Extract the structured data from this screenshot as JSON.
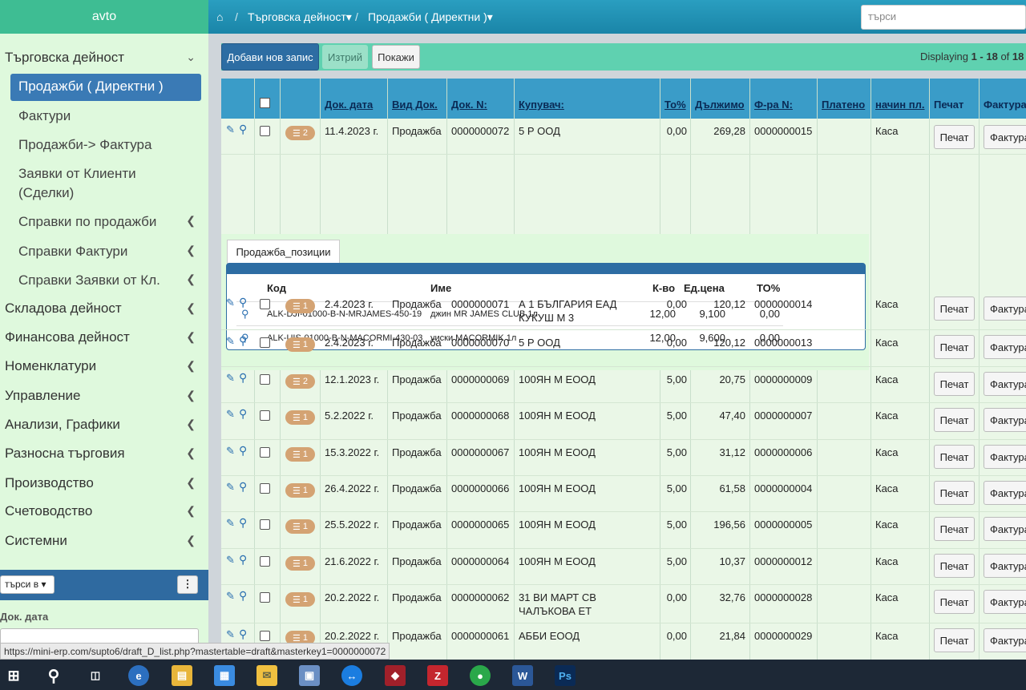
{
  "sidebar": {
    "brand": "avto",
    "section_main": "Търговска дейност",
    "active_item": "Продажби ( Директни )",
    "sub_items": [
      "Фактури",
      "Продажби-> Фактура",
      "Заявки от Клиенти (Сделки)",
      "Справки по продажби",
      "Справки Фактури",
      "Справки Заявки от Кл."
    ],
    "sections": [
      "Складова дейност",
      "Финансова дейност",
      "Номенклатури",
      "Управление",
      "Анализи, Графики",
      "Разносна търговия",
      "Производство",
      "Счетоводство",
      "Системни"
    ],
    "search_in_label": "търси в",
    "doc_date_label": "Док. дата"
  },
  "topbar": {
    "crumb1": "Търговска дейност",
    "crumb2": "Продажби ( Директни )",
    "search_placeholder": "търси"
  },
  "toolbar": {
    "add_label": "Добави нов запис",
    "delete_label": "Изтрий",
    "show_label": "Покажи",
    "displaying_prefix": "Displaying ",
    "displaying_range": "1 - 18",
    "displaying_of": " of ",
    "displaying_total": "18"
  },
  "table": {
    "headers": {
      "doc_date": "Док. дата",
      "doc_type": "Вид Док.",
      "doc_no": "Док. N:",
      "buyer": "Купувач:",
      "to_pct": "То%",
      "due": "Дължимо",
      "invoice_no": "Ф-ра N:",
      "paid": "Платено",
      "pay_method": "начин пл.",
      "print": "Печат",
      "invoice": "Фактура"
    },
    "rows": [
      {
        "badge": "2",
        "date": "11.4.2023 г.",
        "type": "Продажба",
        "no": "0000000072",
        "buyer1": "5 Р ООД",
        "buyer2": "",
        "to": "0,00",
        "due": "269,28",
        "inv": "0000000015",
        "pay": "Каса",
        "print": "Печат",
        "invoice": "Фактура"
      },
      {
        "badge": "1",
        "date": "2.4.2023 г.",
        "type": "Продажба",
        "no": "0000000071",
        "buyer1": "А 1 БЪЛГАРИЯ ЕАД",
        "buyer2": "КУКУШ М 3",
        "to": "0,00",
        "due": "120,12",
        "inv": "0000000014",
        "pay": "Каса",
        "print": "Печат",
        "invoice": "Фактура"
      },
      {
        "badge": "1",
        "date": "2.4.2023 г.",
        "type": "Продажба",
        "no": "0000000070",
        "buyer1": "5 Р ООД",
        "buyer2": "",
        "to": "0,00",
        "due": "120,12",
        "inv": "0000000013",
        "pay": "Каса",
        "print": "Печат",
        "invoice": "Фактура"
      },
      {
        "badge": "2",
        "date": "12.1.2023 г.",
        "type": "Продажба",
        "no": "0000000069",
        "buyer1": "100ЯН М ЕООД",
        "buyer2": "",
        "to": "5,00",
        "due": "20,75",
        "inv": "0000000009",
        "pay": "Каса",
        "print": "Печат",
        "invoice": "Фактура"
      },
      {
        "badge": "1",
        "date": "5.2.2022 г.",
        "type": "Продажба",
        "no": "0000000068",
        "buyer1": "100ЯН М ЕООД",
        "buyer2": "",
        "to": "5,00",
        "due": "47,40",
        "inv": "0000000007",
        "pay": "Каса",
        "print": "Печат",
        "invoice": "Фактура"
      },
      {
        "badge": "1",
        "date": "15.3.2022 г.",
        "type": "Продажба",
        "no": "0000000067",
        "buyer1": "100ЯН М ЕООД",
        "buyer2": "",
        "to": "5,00",
        "due": "31,12",
        "inv": "0000000006",
        "pay": "Каса",
        "print": "Печат",
        "invoice": "Фактура"
      },
      {
        "badge": "1",
        "date": "26.4.2022 г.",
        "type": "Продажба",
        "no": "0000000066",
        "buyer1": "100ЯН М ЕООД",
        "buyer2": "",
        "to": "5,00",
        "due": "61,58",
        "inv": "0000000004",
        "pay": "Каса",
        "print": "Печат",
        "invoice": "Фактура"
      },
      {
        "badge": "1",
        "date": "25.5.2022 г.",
        "type": "Продажба",
        "no": "0000000065",
        "buyer1": "100ЯН М ЕООД",
        "buyer2": "",
        "to": "5,00",
        "due": "196,56",
        "inv": "0000000005",
        "pay": "Каса",
        "print": "Печат",
        "invoice": "Фактура"
      },
      {
        "badge": "1",
        "date": "21.6.2022 г.",
        "type": "Продажба",
        "no": "0000000064",
        "buyer1": "100ЯН М ЕООД",
        "buyer2": "",
        "to": "5,00",
        "due": "10,37",
        "inv": "0000000012",
        "pay": "Каса",
        "print": "Печат",
        "invoice": "Фактура"
      },
      {
        "badge": "1",
        "date": "20.2.2022 г.",
        "type": "Продажба",
        "no": "0000000062",
        "buyer1": "31 ВИ МАРТ СВ",
        "buyer2": "ЧАЛЪКОВА ЕТ",
        "to": "0,00",
        "due": "32,76",
        "inv": "0000000028",
        "pay": "Каса",
        "print": "Печат",
        "invoice": "Фактура"
      },
      {
        "badge": "1",
        "date": "20.2.2022 г.",
        "type": "Продажба",
        "no": "0000000061",
        "buyer1": "АББИ ЕООД",
        "buyer2": "",
        "to": "0,00",
        "due": "21,84",
        "inv": "0000000029",
        "pay": "Каса",
        "print": "Печат",
        "invoice": "Фактура"
      }
    ]
  },
  "detail": {
    "tab_label": "Продажба_позиции",
    "headers": {
      "code": "Код",
      "name": "Име",
      "qty": "К-во",
      "price": "Ед.цена",
      "to": "ТО%"
    },
    "items": [
      {
        "code": "ALK-DJI-01000-B-N-MRJAMES-450-19",
        "name": "джин MR JAMES CLUB 1л",
        "qty": "12,00",
        "price": "9,100",
        "to": "0,00"
      },
      {
        "code": "ALK-UIS-01000-B-N-MACORMI-430-03",
        "name": "уиски MACORMIK 1л",
        "qty": "12,00",
        "price": "9,600",
        "to": "0,00"
      }
    ]
  },
  "status_url": "https://mini-erp.com/supto6/draft_D_list.php?mastertable=draft&masterkey1=0000000072",
  "taskbar_icons": [
    "windows-icon",
    "search-icon",
    "task-view-icon",
    "edge-icon",
    "file-explorer-icon",
    "store-icon",
    "mail-icon",
    "computer-icon",
    "teamviewer-icon",
    "ruby-icon",
    "filezilla-icon",
    "green-app-icon",
    "word-icon",
    "photoshop-icon"
  ]
}
